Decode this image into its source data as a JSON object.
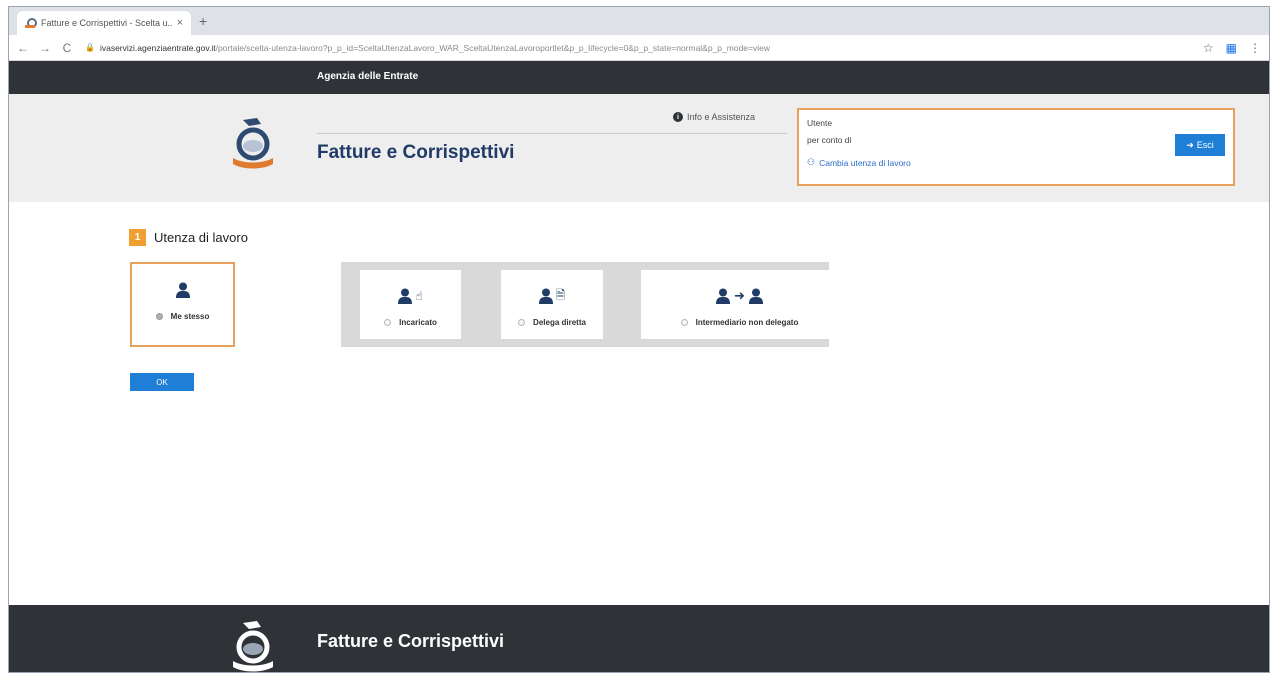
{
  "browser": {
    "tab_title": "Fatture e Corrispettivi - Scelta u...",
    "tab_close": "×",
    "new_tab": "+",
    "back": "←",
    "forward": "→",
    "reload": "C",
    "url_host": "ivaservizi.agenziaentrate.gov.it",
    "url_path": "/portale/scelta-utenza-lavoro?p_p_id=SceltaUtenzaLavoro_WAR_SceltaUtenzaLavoroportlet&p_p_lifecycle=0&p_p_state=normal&p_p_mode=view",
    "star": "☆"
  },
  "topbar": {
    "title": "Agenzia delle Entrate"
  },
  "header": {
    "app_title": "Fatture e Corrispettivi",
    "info_label": "Info e Assistenza",
    "info_icon": "i",
    "user_label": "Utente",
    "for_label": "per conto di",
    "change_link": "Cambia utenza di lavoro",
    "exit_label": "Esci"
  },
  "main": {
    "step_number": "1",
    "step_title": "Utenza di lavoro",
    "options": [
      {
        "label": "Me stesso",
        "selected": true
      },
      {
        "label": "Incaricato",
        "selected": false
      },
      {
        "label": "Delega diretta",
        "selected": false
      },
      {
        "label": "Intermediario non delegato",
        "selected": false
      }
    ],
    "ok_label": "OK"
  },
  "footer": {
    "title": "Fatture e Corrispettivi"
  },
  "colors": {
    "dark_bar": "#2f3338",
    "accent_orange": "#e8a15c",
    "button_blue": "#1f7fd6",
    "title_navy": "#1f3b66"
  },
  "icons": {
    "person": "person-icon",
    "hand_pointer": "hand-pointer-icon",
    "document": "document-icon",
    "arrow_right": "arrow-right-icon",
    "users": "users-icon",
    "sign_out": "sign-out-icon"
  }
}
